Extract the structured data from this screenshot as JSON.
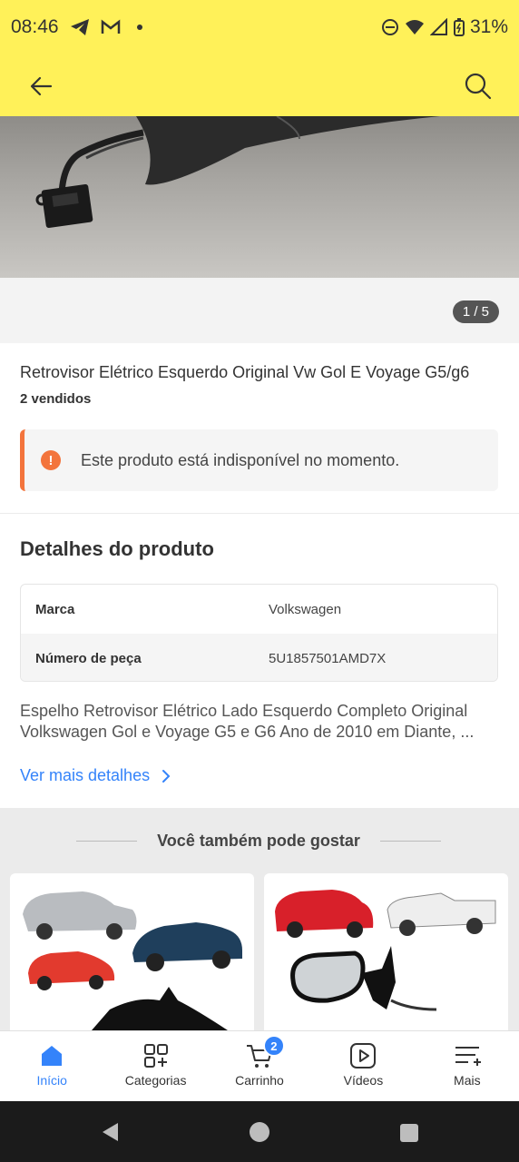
{
  "status_bar": {
    "time": "08:46",
    "battery": "31%"
  },
  "app_bar": {
    "back_icon": "arrow-left-icon",
    "search_icon": "search-icon"
  },
  "gallery": {
    "counter": "1 / 5"
  },
  "product": {
    "title": "Retrovisor Elétrico Esquerdo Original Vw Gol E Voyage G5/g6",
    "sold": "2 vendidos",
    "alert": "Este produto está indisponível no momento."
  },
  "details": {
    "heading": "Detalhes do produto",
    "specs": [
      {
        "label": "Marca",
        "value": "Volkswagen"
      },
      {
        "label": "Número de peça",
        "value": "5U1857501AMD7X"
      }
    ],
    "description_line1": "Espelho Retrovisor Elétrico Lado Esquerdo Completo Original",
    "description_line2": "Volkswagen Gol e Voyage G5 e G6 Ano de 2010 em Diante, ...",
    "more_link": "Ver mais detalhes"
  },
  "recommendations": {
    "heading": "Você também pode gostar"
  },
  "bottom_nav": {
    "items": [
      {
        "label": "Início",
        "icon": "home-icon"
      },
      {
        "label": "Categorias",
        "icon": "categories-icon"
      },
      {
        "label": "Carrinho",
        "icon": "cart-icon",
        "badge": "2"
      },
      {
        "label": "Vídeos",
        "icon": "play-icon"
      },
      {
        "label": "Mais",
        "icon": "more-icon"
      }
    ]
  },
  "colors": {
    "brand_yellow": "#fff159",
    "accent_blue": "#3483fa",
    "alert_orange": "#f3743c"
  }
}
